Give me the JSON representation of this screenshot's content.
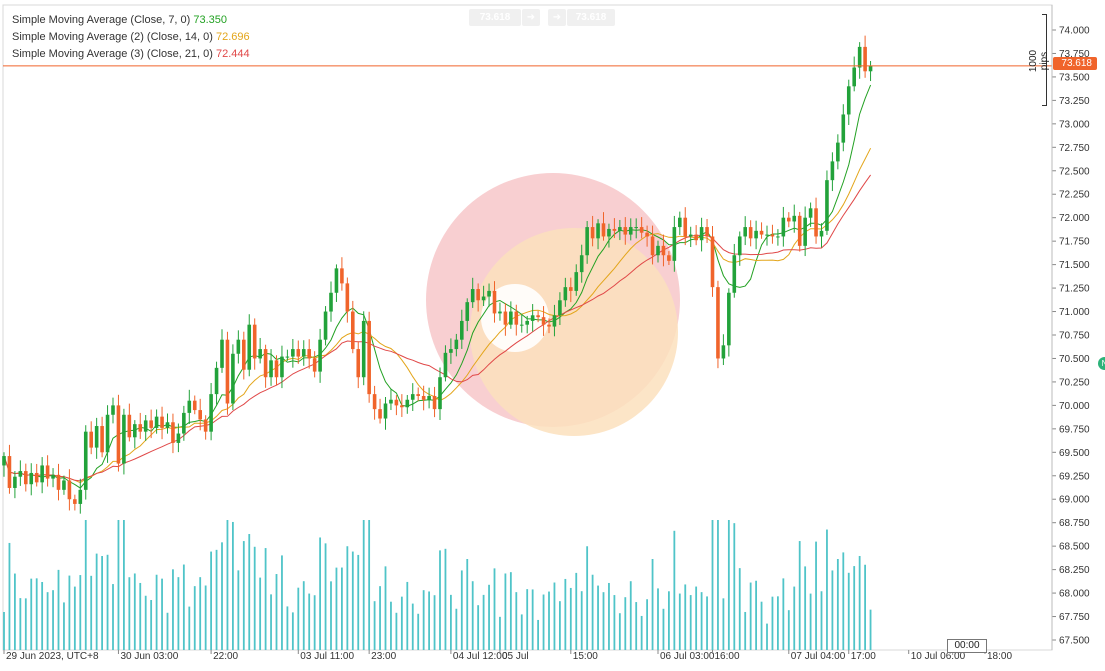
{
  "legend": {
    "sma1": {
      "label": "Simple Moving Average (Close, 7, 0)",
      "value": "73.350",
      "color": "#22a122"
    },
    "sma2": {
      "label": "Simple Moving Average (2) (Close, 14, 0)",
      "value": "72.696",
      "color": "#e3a51a"
    },
    "sma3": {
      "label": "Simple Moving Average (3) (Close, 21, 0)",
      "value": "72.444",
      "color": "#e04848"
    }
  },
  "top_bar": {
    "bid": "73.618",
    "arrow_left": "➜",
    "arrow_right": "➜",
    "ask": "73.618"
  },
  "price_tag": "73.618",
  "pips_label": "1000 pips",
  "time_tag": "00:00",
  "edge_badge": "N",
  "colors": {
    "up": "#22a23a",
    "down": "#f0642b",
    "volume": "#4fc4c8",
    "price_line": "#f0642b",
    "grid": "#e8e8e8"
  },
  "chart_data": {
    "type": "candlestick",
    "title": "",
    "y_axis": {
      "range": [
        67.4,
        74.2
      ],
      "ticks": [
        "74.000",
        "73.750",
        "73.500",
        "73.250",
        "73.000",
        "72.750",
        "72.500",
        "72.250",
        "72.000",
        "71.750",
        "71.500",
        "71.250",
        "71.000",
        "70.750",
        "70.500",
        "70.250",
        "70.000",
        "69.750",
        "69.500",
        "69.250",
        "69.000",
        "68.750",
        "68.500",
        "68.250",
        "68.000",
        "67.750",
        "67.500"
      ]
    },
    "x_axis": {
      "tick_labels": [
        "29 Jun 2023, UTC+8",
        "30 Jun 03:00",
        "22:00",
        "03 Jul 11:00",
        "23:00",
        "04 Jul 12:00",
        "05 Jul",
        "15:00",
        "06 Jul 03:00",
        "16:00",
        "07 Jul 04:00",
        "17:00",
        "10 Jul 06:00",
        "18:00"
      ],
      "tick_index": [
        0,
        21,
        38,
        54,
        67,
        82,
        91,
        104,
        120,
        130,
        144,
        155,
        166,
        180
      ]
    },
    "last_price": 73.618,
    "closes": [
      69.46,
      69.12,
      69.24,
      69.3,
      69.16,
      69.28,
      69.18,
      69.36,
      69.22,
      69.26,
      69.1,
      69.2,
      69.0,
      68.95,
      69.1,
      69.72,
      69.55,
      69.78,
      69.5,
      69.9,
      70.0,
      69.38,
      69.9,
      69.66,
      69.8,
      69.72,
      69.84,
      69.76,
      69.88,
      69.76,
      69.82,
      69.6,
      69.7,
      69.92,
      70.05,
      69.95,
      69.85,
      69.72,
      70.12,
      70.4,
      70.7,
      70.02,
      70.55,
      70.7,
      70.38,
      70.86,
      70.5,
      70.6,
      70.3,
      70.48,
      70.3,
      70.52,
      70.52,
      70.6,
      70.52,
      70.6,
      70.5,
      70.36,
      70.7,
      71.0,
      71.2,
      71.46,
      71.3,
      71.0,
      70.6,
      70.3,
      70.9,
      70.12,
      69.96,
      69.86,
      70.02,
      70.06,
      70.0,
      69.98,
      70.06,
      70.12,
      70.1,
      70.06,
      70.1,
      69.96,
      70.3,
      70.56,
      70.6,
      70.7,
      70.9,
      71.1,
      71.24,
      71.12,
      71.16,
      71.22,
      70.98,
      71.0,
      70.86,
      71.0,
      70.86,
      70.86,
      70.9,
      70.96,
      70.94,
      70.86,
      70.84,
      70.96,
      71.12,
      71.26,
      71.22,
      71.42,
      71.6,
      71.9,
      71.78,
      71.94,
      71.8,
      71.88,
      71.86,
      71.9,
      71.82,
      71.9,
      71.9,
      71.84,
      71.8,
      71.6,
      71.7,
      71.6,
      71.54,
      71.9,
      72.0,
      71.8,
      71.82,
      71.76,
      71.9,
      71.8,
      71.26,
      70.5,
      70.64,
      71.2,
      71.6,
      71.8,
      71.9,
      71.78,
      71.86,
      71.82,
      71.82,
      71.8,
      71.8,
      72.0,
      71.96,
      72.02,
      71.7,
      72.0,
      72.1,
      71.8,
      71.86,
      72.4,
      72.6,
      72.8,
      73.1,
      73.4,
      73.6,
      73.82,
      73.56,
      73.62
    ],
    "sma": {
      "period_7": {
        "color": "#22a122",
        "last": 73.35
      },
      "period_14": {
        "color": "#e3a51a",
        "last": 72.696
      },
      "period_21": {
        "color": "#e04848",
        "last": 72.444
      }
    },
    "volume_note": "volume bars in teal at bottom, unlabeled"
  }
}
